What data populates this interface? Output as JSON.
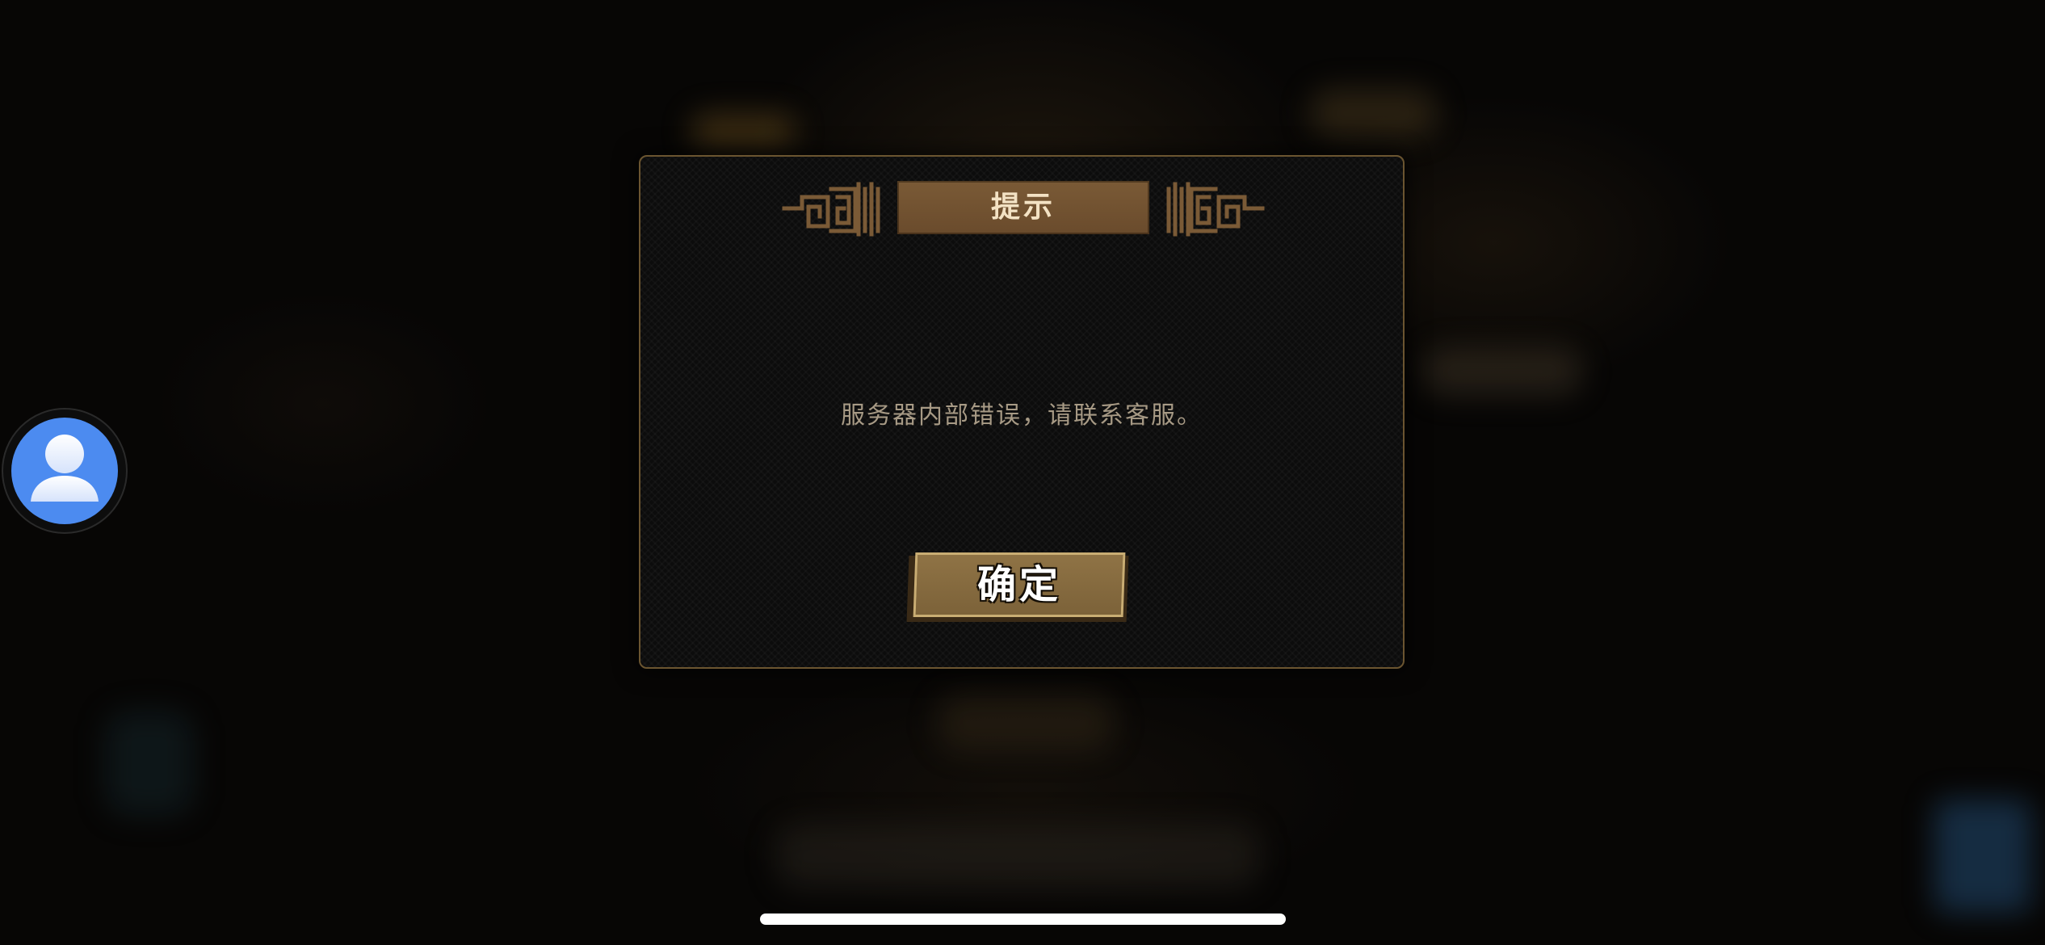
{
  "dialog": {
    "title": "提示",
    "message": "服务器内部错误，请联系客服。",
    "confirm_label": "确定"
  },
  "icons": {
    "assistant_avatar": "person-icon",
    "title_ornament": "fret-ornament-icon"
  },
  "colors": {
    "modal_border": "#6b5530",
    "title_plate": "#7a5a36",
    "title_text": "#f3e2c4",
    "message_text": "#a79a85",
    "button_face": "#8f7345",
    "button_border": "#c9ad73",
    "avatar_bg": "#4c8bf0"
  }
}
